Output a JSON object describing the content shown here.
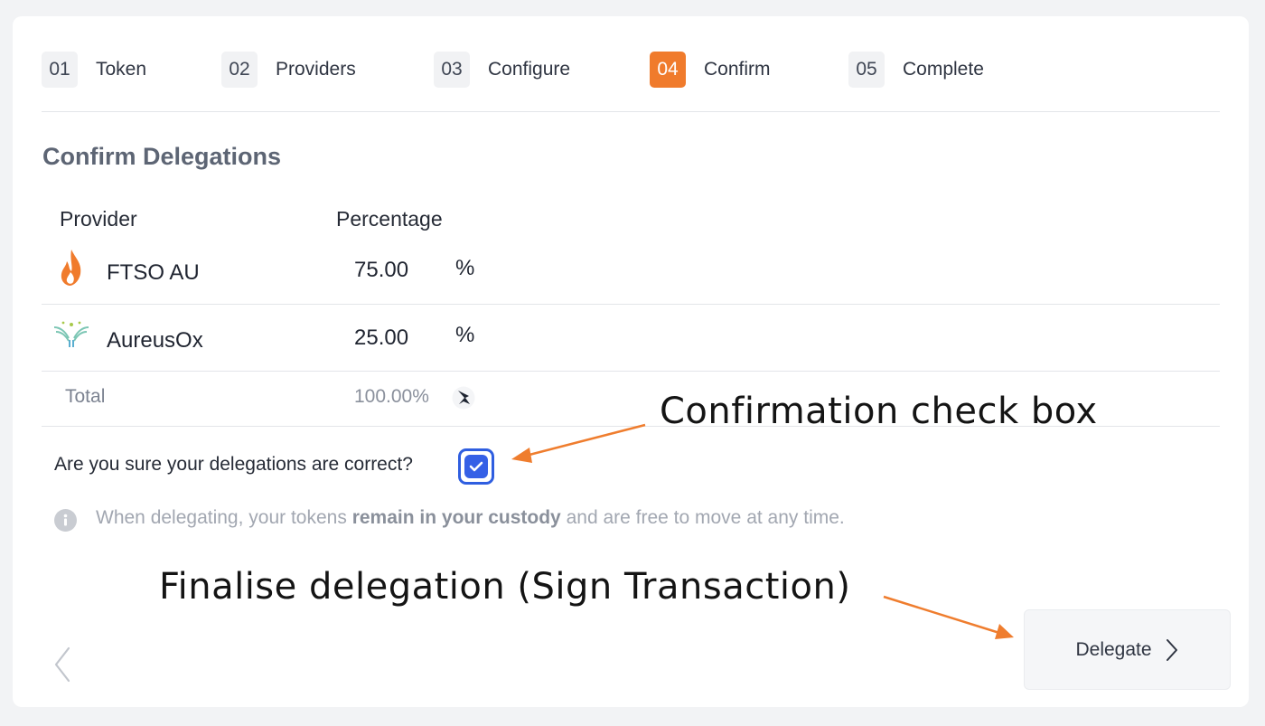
{
  "stepper": {
    "steps": [
      {
        "num": "01",
        "label": "Token"
      },
      {
        "num": "02",
        "label": "Providers"
      },
      {
        "num": "03",
        "label": "Configure"
      },
      {
        "num": "04",
        "label": "Confirm",
        "active": true
      },
      {
        "num": "05",
        "label": "Complete"
      }
    ]
  },
  "confirm": {
    "title": "Confirm Delegations",
    "headers": {
      "provider": "Provider",
      "percentage": "Percentage"
    },
    "rows": [
      {
        "name": "FTSO AU",
        "value": "75.00",
        "unit": "%",
        "icon": "flame-icon"
      },
      {
        "name": "AureusOx",
        "value": "25.00",
        "unit": "%",
        "icon": "aureusox-logo-icon"
      }
    ],
    "total": {
      "label": "Total",
      "value": "100.00%",
      "icon": "bird-icon"
    },
    "question": "Are you sure your delegations are correct?",
    "checkbox_checked": true,
    "info": {
      "prefix": "When delegating, your tokens ",
      "bold": "remain in your custody",
      "suffix": " and are free to move at any time."
    }
  },
  "annotations": {
    "checkbox_note": "Confirmation check box",
    "delegate_note": "Finalise delegation (Sign Transaction)"
  },
  "actions": {
    "delegate_label": "Delegate"
  },
  "colors": {
    "accent": "#f07b2c",
    "checkbox": "#3560e6",
    "annotation_arrow": "#ef7d2e"
  }
}
